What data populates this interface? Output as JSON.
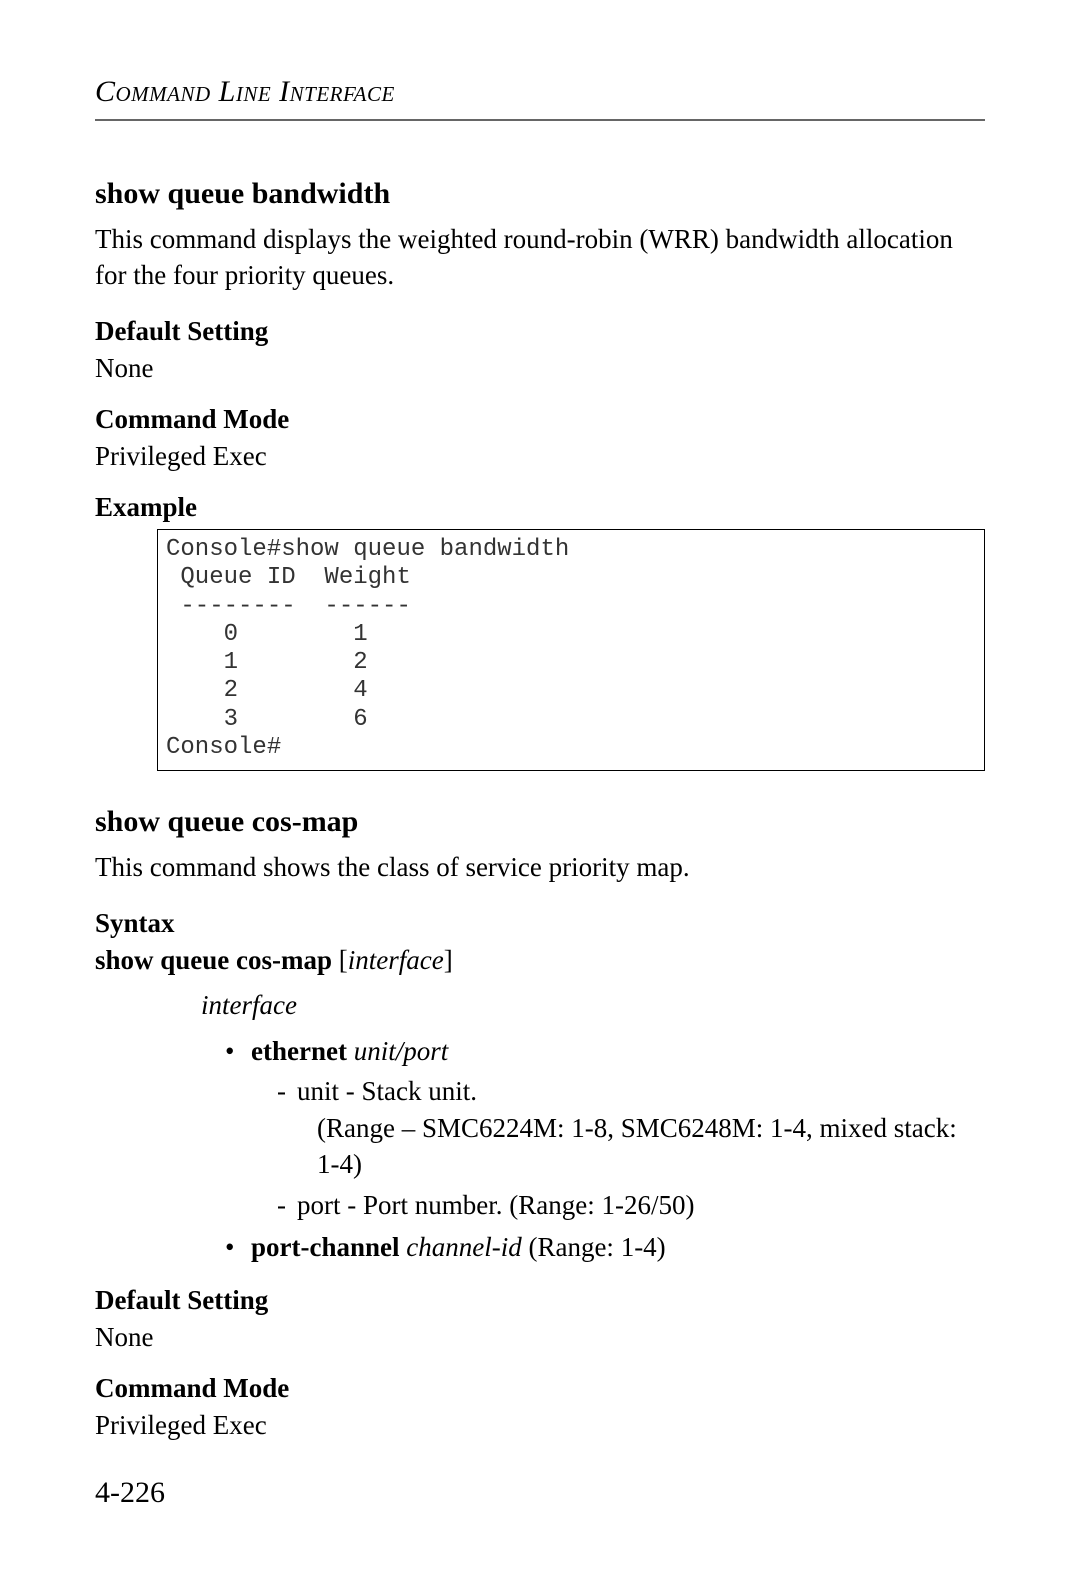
{
  "running_head": "Command Line Interface",
  "section1": {
    "title": "show queue bandwidth",
    "desc": "This command displays the weighted round-robin (WRR) bandwidth allocation for the four priority queues.",
    "default_label": "Default Setting",
    "default_value": "None",
    "mode_label": "Command Mode",
    "mode_value": "Privileged Exec",
    "example_label": "Example",
    "example_code": "Console#show queue bandwidth\n Queue ID  Weight\n --------  ------\n    0        1\n    1        2\n    2        4\n    3        6\nConsole#"
  },
  "section2": {
    "title": "show queue cos-map",
    "desc": "This command shows the class of service priority map.",
    "syntax_label": "Syntax",
    "syntax_cmd": "show queue cos-map",
    "syntax_arg": "interface",
    "param_word": "interface",
    "bullet1_kw": "ethernet",
    "bullet1_arg": "unit/port",
    "unit_line": "unit - Stack unit.",
    "unit_range": "(Range – SMC6224M: 1-8, SMC6248M: 1-4, mixed stack: 1-4)",
    "port_line": "port - Port number. (Range: 1-26/50)",
    "bullet2_kw": "port-channel",
    "bullet2_arg": "channel-id",
    "bullet2_tail": " (Range: 1-4)",
    "default_label": "Default Setting",
    "default_value": "None",
    "mode_label": "Command Mode",
    "mode_value": "Privileged Exec"
  },
  "page_number": "4-226"
}
